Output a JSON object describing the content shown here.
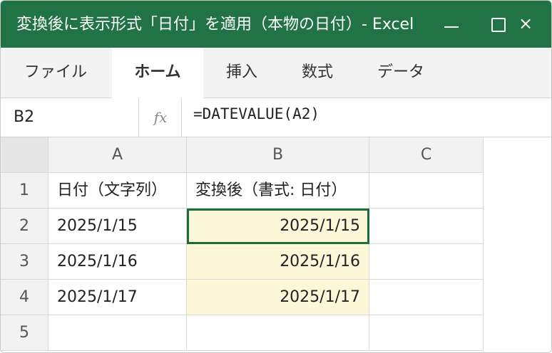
{
  "window": {
    "title": "変換後に表示形式「日付」を適用（本物の日付）- Excel",
    "accent": "#217346",
    "controls": {
      "minimize": "—",
      "maximize": "☐",
      "close": "×"
    }
  },
  "ribbon": {
    "tabs": [
      "ファイル",
      "ホーム",
      "挿入",
      "数式",
      "データ"
    ],
    "active_tab": "ホーム"
  },
  "formula_bar": {
    "name_box": "B2",
    "fx_label": "fx",
    "formula": "=DATEVALUE(A2)"
  },
  "sheet": {
    "columns": [
      "A",
      "B",
      "C"
    ],
    "rows": [
      "1",
      "2",
      "3",
      "4",
      "5"
    ],
    "cells": [
      [
        "日付（文字列）",
        "変換後（書式: 日付）",
        ""
      ],
      [
        "2025/1/15",
        "2025/1/15",
        ""
      ],
      [
        "2025/1/16",
        "2025/1/16",
        ""
      ],
      [
        "2025/1/17",
        "2025/1/17",
        ""
      ],
      [
        "",
        "",
        ""
      ]
    ],
    "selected_cell": "B2",
    "formatted_fill": "#fdf7d9",
    "selection_color": "#1e6b3c"
  }
}
